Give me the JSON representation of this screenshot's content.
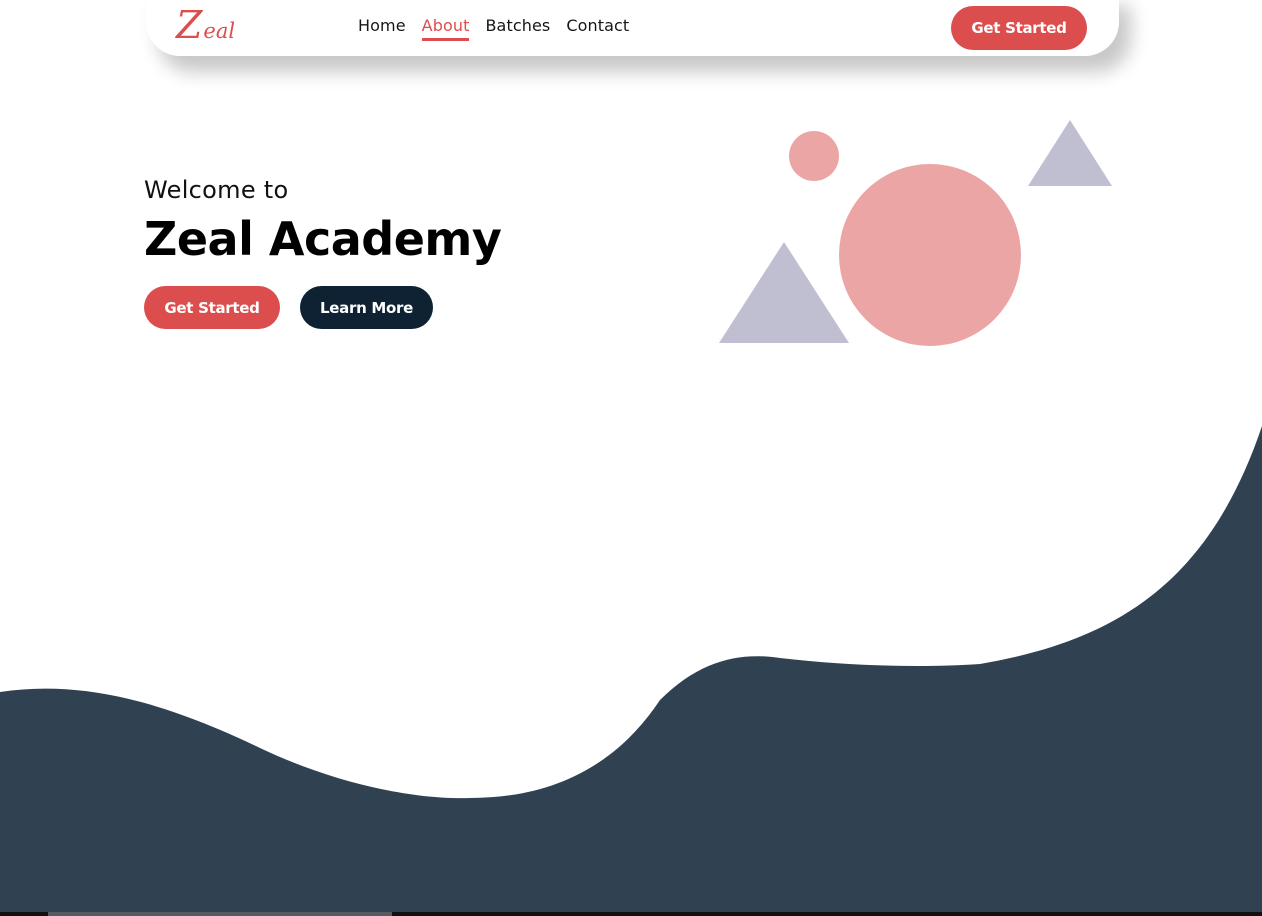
{
  "brand": {
    "logo_initial": "Z",
    "logo_rest": "eal",
    "accent_color": "#dc4e4e",
    "navy_color": "#0f2233",
    "wave_color": "#304252"
  },
  "nav": {
    "links": [
      {
        "label": "Home",
        "active": false
      },
      {
        "label": "About",
        "active": true
      },
      {
        "label": "Batches",
        "active": false
      },
      {
        "label": "Contact",
        "active": false
      }
    ],
    "cta_label": "Get Started"
  },
  "hero": {
    "kicker": "Welcome to",
    "title": "Zeal Academy",
    "primary_button": "Get Started",
    "secondary_button": "Learn More"
  },
  "decor": {
    "circle_color": "#eca5a5",
    "triangle_color": "#c0bfd2"
  }
}
